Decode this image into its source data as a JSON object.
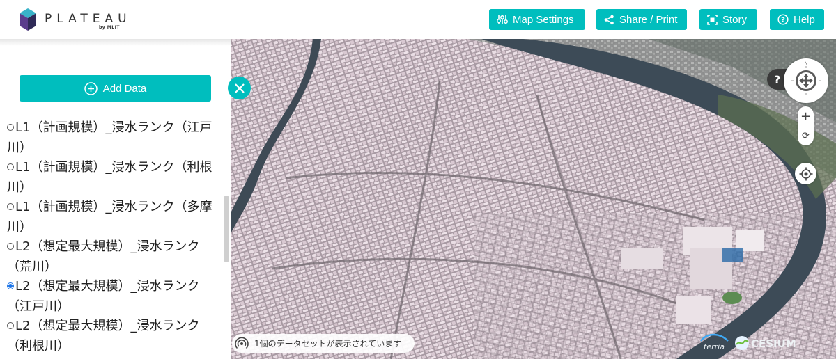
{
  "header": {
    "logo_text": "PLATEAU",
    "logo_sub": "by MLIT",
    "buttons": {
      "map_settings": "Map Settings",
      "share_print": "Share / Print",
      "story": "Story",
      "help": "Help"
    }
  },
  "panel": {
    "add_data_label": "Add Data",
    "items": [
      {
        "label": "L1（計画規模）_浸水ランク（江戸川）",
        "selected": false
      },
      {
        "label": "L1（計画規模）_浸水ランク（利根川）",
        "selected": false
      },
      {
        "label": "L1（計画規模）_浸水ランク（多摩川）",
        "selected": false
      },
      {
        "label": "L2（想定最大規模）_浸水ランク（荒川）",
        "selected": false
      },
      {
        "label": "L2（想定最大規模）_浸水ランク（江戸川）",
        "selected": true
      },
      {
        "label": "L2（想定最大規模）_浸水ランク（利根川）",
        "selected": false
      }
    ]
  },
  "map": {
    "help_button": "?",
    "compass_north": "N",
    "zoom_in": "+",
    "zoom_reset": "⟳",
    "dataset_status": "1個のデータセットが表示されています",
    "credit_terria": "terria",
    "credit_cesium": "CESIUM"
  },
  "colors": {
    "accent": "#00bebe",
    "selected_radio": "#1a73e8"
  }
}
